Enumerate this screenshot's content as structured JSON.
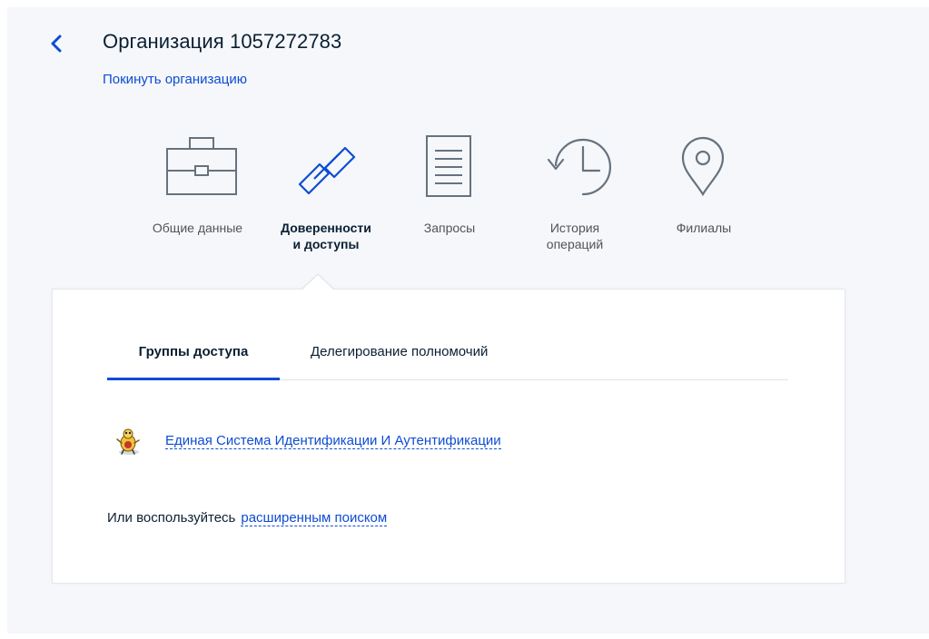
{
  "header": {
    "title": "Организация 1057272783",
    "leave_link": "Покинуть организацию"
  },
  "nav": {
    "items": [
      {
        "label": "Общие данные",
        "icon": "briefcase-icon",
        "active": false
      },
      {
        "label": "Доверенности\nи доступы",
        "icon": "link-chain-icon",
        "active": true
      },
      {
        "label": "Запросы",
        "icon": "document-icon",
        "active": false
      },
      {
        "label": "История\nопераций",
        "icon": "history-clock-icon",
        "active": false
      },
      {
        "label": "Филиалы",
        "icon": "map-pin-icon",
        "active": false
      }
    ]
  },
  "tabs": {
    "items": [
      {
        "label": "Группы доступа",
        "active": true
      },
      {
        "label": "Делегирование полномочий",
        "active": false
      }
    ]
  },
  "services": {
    "items": [
      {
        "name": "Единая Система Идентификации И Аутентификации",
        "icon": "esia-logo-icon"
      }
    ]
  },
  "search": {
    "prefix": "Или воспользуйтесь",
    "link": "расширенным поиском"
  },
  "colors": {
    "accent": "#0d4cd3",
    "text": "#0b1f33",
    "muted": "#535353",
    "icon_gray": "#66727f",
    "background": "#f5f7fa"
  }
}
